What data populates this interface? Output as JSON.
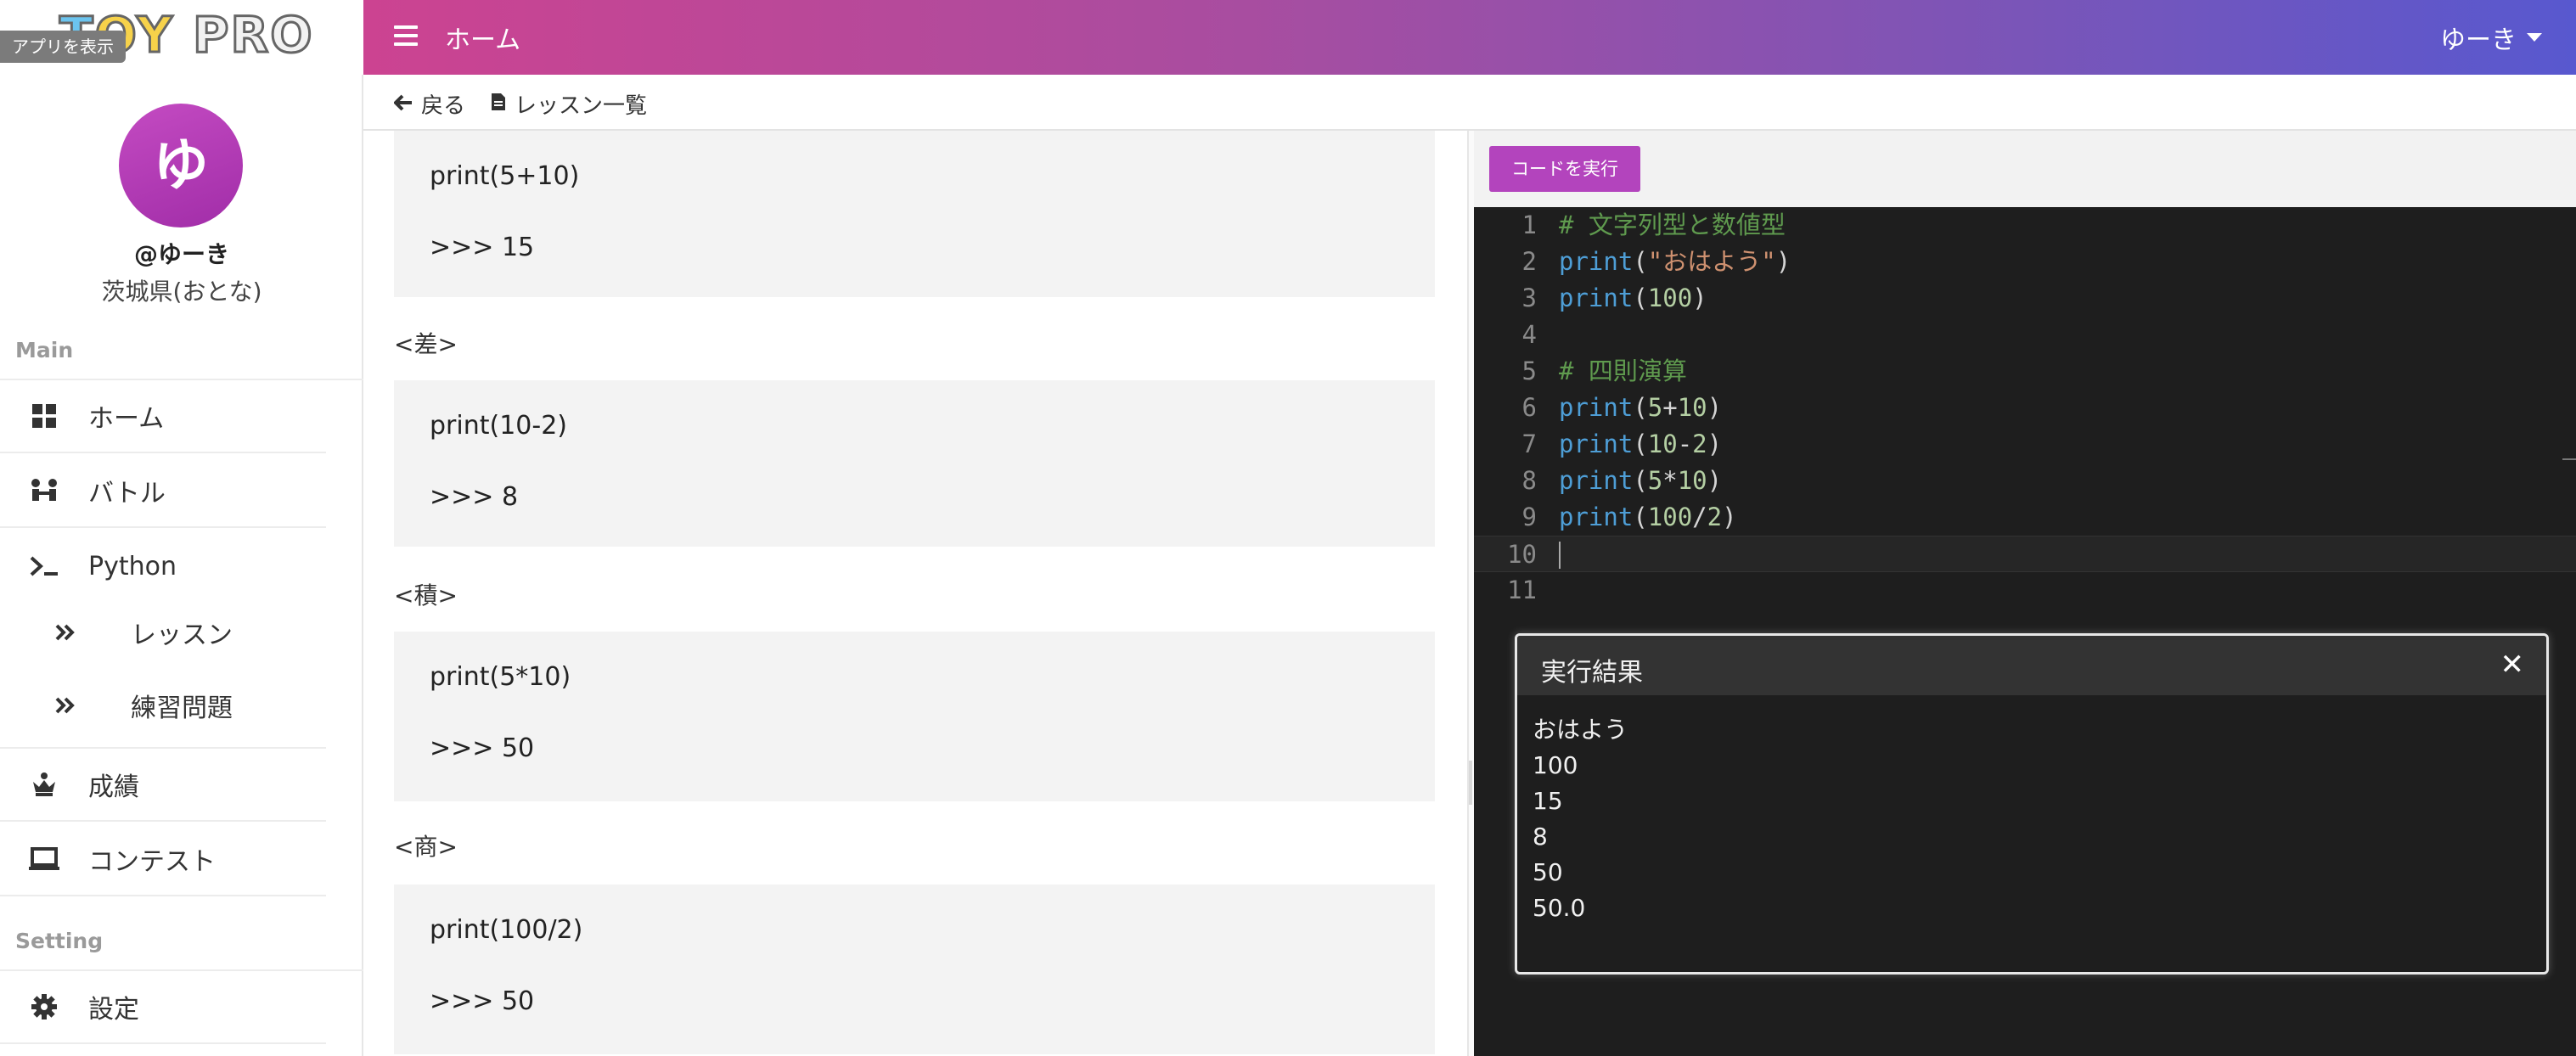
{
  "app": {
    "logo_text": "TOY PRO",
    "app_badge": "アプリを表示"
  },
  "profile": {
    "avatar_initial": "ゆ",
    "handle": "@ゆーき",
    "region": "茨城県(おとな)"
  },
  "sidebar": {
    "main_title": "Main",
    "setting_title": "Setting",
    "items": [
      {
        "label": "ホーム",
        "icon": "grid-icon"
      },
      {
        "label": "バトル",
        "icon": "battle-icon"
      },
      {
        "label": "Python",
        "icon": "terminal-icon"
      },
      {
        "label": "レッスン",
        "icon": "double-chevron-icon"
      },
      {
        "label": "練習問題",
        "icon": "double-chevron-icon"
      },
      {
        "label": "成績",
        "icon": "crown-icon"
      },
      {
        "label": "コンテスト",
        "icon": "laptop-icon"
      },
      {
        "label": "設定",
        "icon": "gear-icon"
      }
    ]
  },
  "header": {
    "title": "ホーム",
    "user_menu": "ゆーき"
  },
  "subbar": {
    "back": "戻る",
    "lessons": "レッスン一覧"
  },
  "lesson": {
    "blocks": [
      {
        "code": "print(5+10)",
        "output": ">>> 15"
      },
      {
        "label": "<差>",
        "code": "print(10-2)",
        "output": ">>> 8"
      },
      {
        "label": "<積>",
        "code": "print(5*10)",
        "output": ">>> 50"
      },
      {
        "label": "<商>",
        "code": "print(100/2)",
        "output": ">>> 50"
      }
    ]
  },
  "editor": {
    "run_button": "コードを実行",
    "lines": [
      {
        "n": "1",
        "text": "# 文字列型と数値型"
      },
      {
        "n": "2",
        "text": "print(\"おはよう\")"
      },
      {
        "n": "3",
        "text": "print(100)"
      },
      {
        "n": "4",
        "text": ""
      },
      {
        "n": "5",
        "text": "# 四則演算"
      },
      {
        "n": "6",
        "text": "print(5+10)"
      },
      {
        "n": "7",
        "text": "print(10-2)"
      },
      {
        "n": "8",
        "text": "print(5*10)"
      },
      {
        "n": "9",
        "text": "print(100/2)"
      },
      {
        "n": "10",
        "text": ""
      },
      {
        "n": "11",
        "text": ""
      }
    ],
    "active_line": "10"
  },
  "result": {
    "title": "実行結果",
    "close": "✕",
    "output": [
      "おはよう",
      "100",
      "15",
      "8",
      "50",
      "50.0"
    ]
  }
}
